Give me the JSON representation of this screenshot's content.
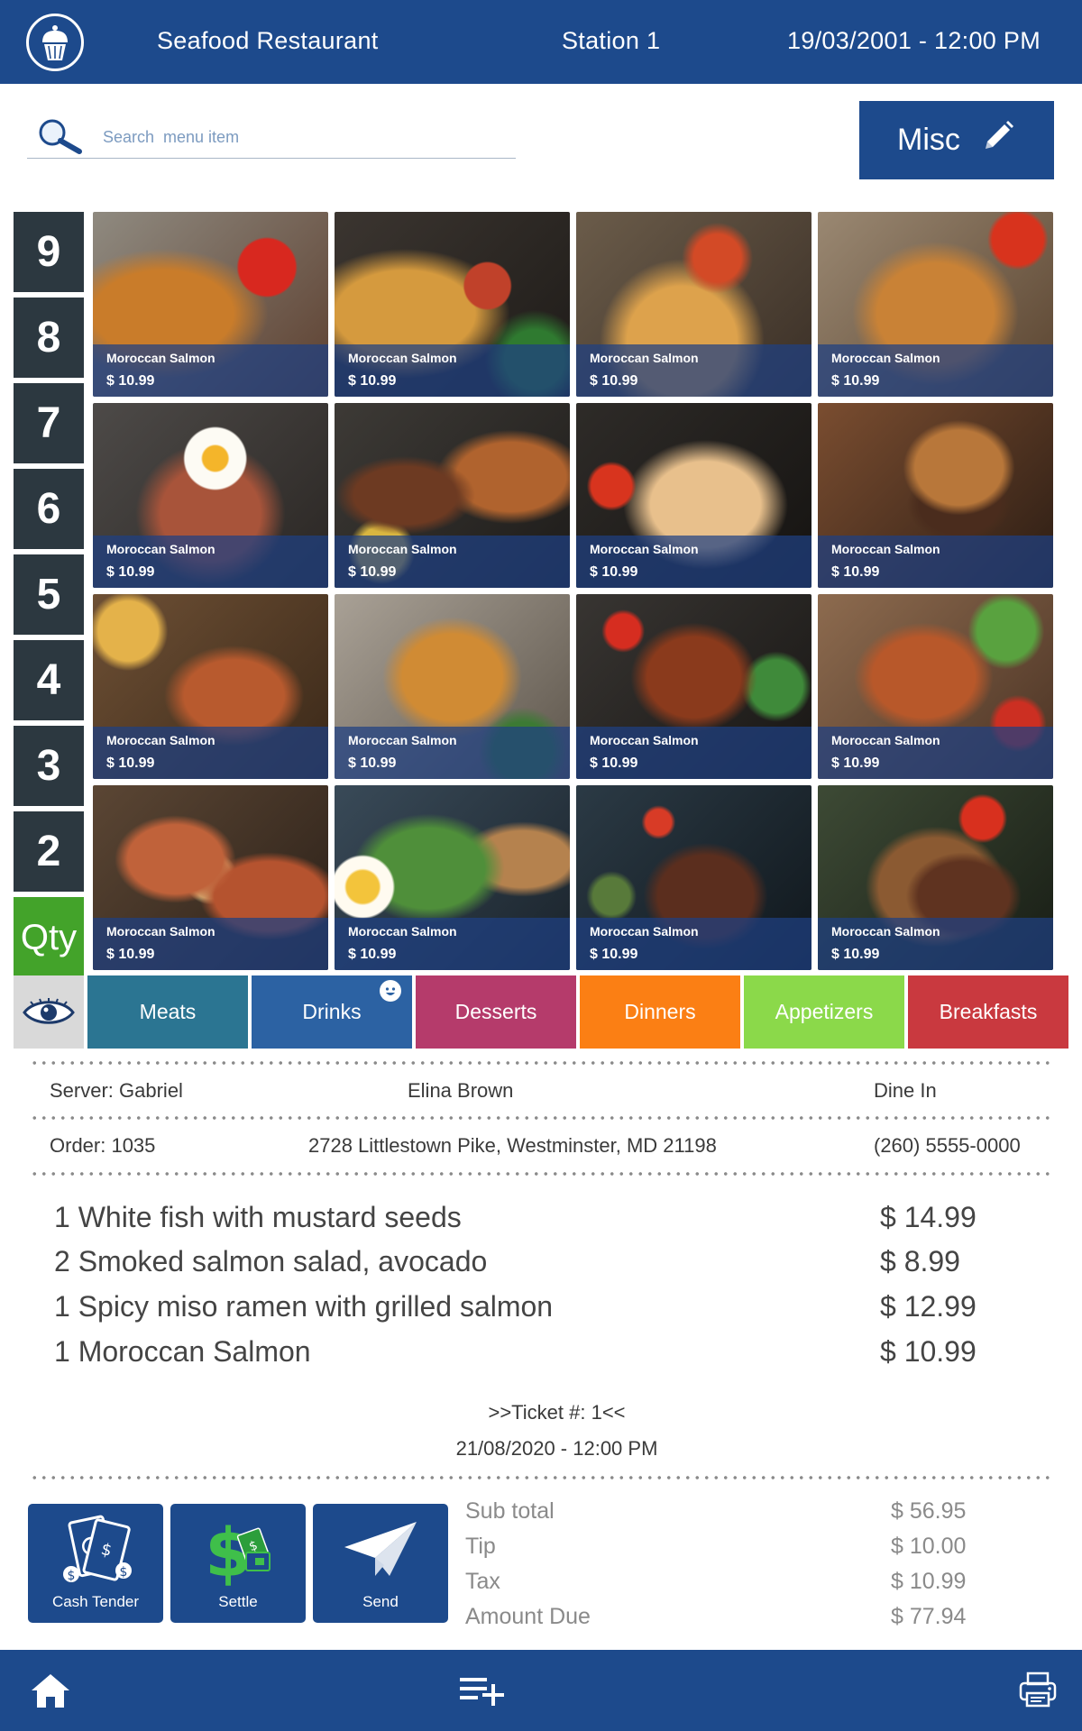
{
  "header": {
    "title": "Seafood Restaurant",
    "station": "Station 1",
    "datetime": "19/03/2001 - 12:00 PM",
    "logo_icon": "cupcake-icon"
  },
  "search": {
    "placeholder": "Search  menu item",
    "value": ""
  },
  "misc": {
    "label": "Misc",
    "icon": "pencil-icon"
  },
  "qty": {
    "numbers": [
      "9",
      "8",
      "7",
      "6",
      "5",
      "4",
      "3",
      "2"
    ],
    "label": "Qty"
  },
  "menu": {
    "items": [
      {
        "name": "Moroccan Salmon",
        "price": "$ 10.99"
      },
      {
        "name": "Moroccan Salmon",
        "price": "$ 10.99"
      },
      {
        "name": "Moroccan Salmon",
        "price": "$ 10.99"
      },
      {
        "name": "Moroccan Salmon",
        "price": "$ 10.99"
      },
      {
        "name": "Moroccan Salmon",
        "price": "$ 10.99"
      },
      {
        "name": "Moroccan Salmon",
        "price": "$ 10.99"
      },
      {
        "name": "Moroccan Salmon",
        "price": "$ 10.99"
      },
      {
        "name": "Moroccan Salmon",
        "price": "$ 10.99"
      },
      {
        "name": "Moroccan Salmon",
        "price": "$ 10.99"
      },
      {
        "name": "Moroccan Salmon",
        "price": "$ 10.99"
      },
      {
        "name": "Moroccan Salmon",
        "price": "$ 10.99"
      },
      {
        "name": "Moroccan Salmon",
        "price": "$ 10.99"
      },
      {
        "name": "Moroccan Salmon",
        "price": "$ 10.99"
      },
      {
        "name": "Moroccan Salmon",
        "price": "$ 10.99"
      },
      {
        "name": "Moroccan Salmon",
        "price": "$ 10.99"
      },
      {
        "name": "Moroccan Salmon",
        "price": "$ 10.99"
      }
    ]
  },
  "categories": {
    "items": [
      {
        "label": "Meats",
        "color": "#2b7592"
      },
      {
        "label": "Drinks",
        "color": "#2c62a3"
      },
      {
        "label": "Desserts",
        "color": "#b53b6b"
      },
      {
        "label": "Dinners",
        "color": "#fb7f14"
      },
      {
        "label": "Appetizers",
        "color": "#8bd94a"
      },
      {
        "label": "Breakfasts",
        "color": "#c9393f"
      }
    ]
  },
  "order": {
    "server": "Server: Gabriel",
    "customer": "Elina Brown",
    "type": "Dine In",
    "number": "Order: 1035",
    "address": "2728 Littlestown Pike, Westminster, MD 21198",
    "phone": "(260) 5555-0000",
    "lines": [
      {
        "name": "1 White fish with mustard seeds",
        "price": "$ 14.99"
      },
      {
        "name": "2 Smoked salmon salad, avocado",
        "price": "$ 8.99"
      },
      {
        "name": "1 Spicy miso ramen with grilled salmon",
        "price": "$ 12.99"
      },
      {
        "name": "1 Moroccan Salmon",
        "price": "$ 10.99"
      }
    ],
    "ticket": ">>Ticket #: 1<<",
    "ticket_datetime": "21/08/2020 - 12:00 PM"
  },
  "actions": {
    "cash_tender": "Cash Tender",
    "settle": "Settle",
    "send": "Send"
  },
  "totals": {
    "subtotal_label": "Sub total",
    "subtotal": "$ 56.95",
    "tip_label": "Tip",
    "tip": "$ 10.00",
    "tax_label": "Tax",
    "tax": "$ 10.99",
    "due_label": "Amount Due",
    "due": "$ 77.94"
  },
  "bottom_bar": {
    "icons": [
      "home-icon",
      "add-list-icon",
      "printer-icon"
    ]
  },
  "colors": {
    "primary": "#1d4a8c",
    "qty_active": "#43a32a",
    "qty_dark": "#2c38340"
  }
}
